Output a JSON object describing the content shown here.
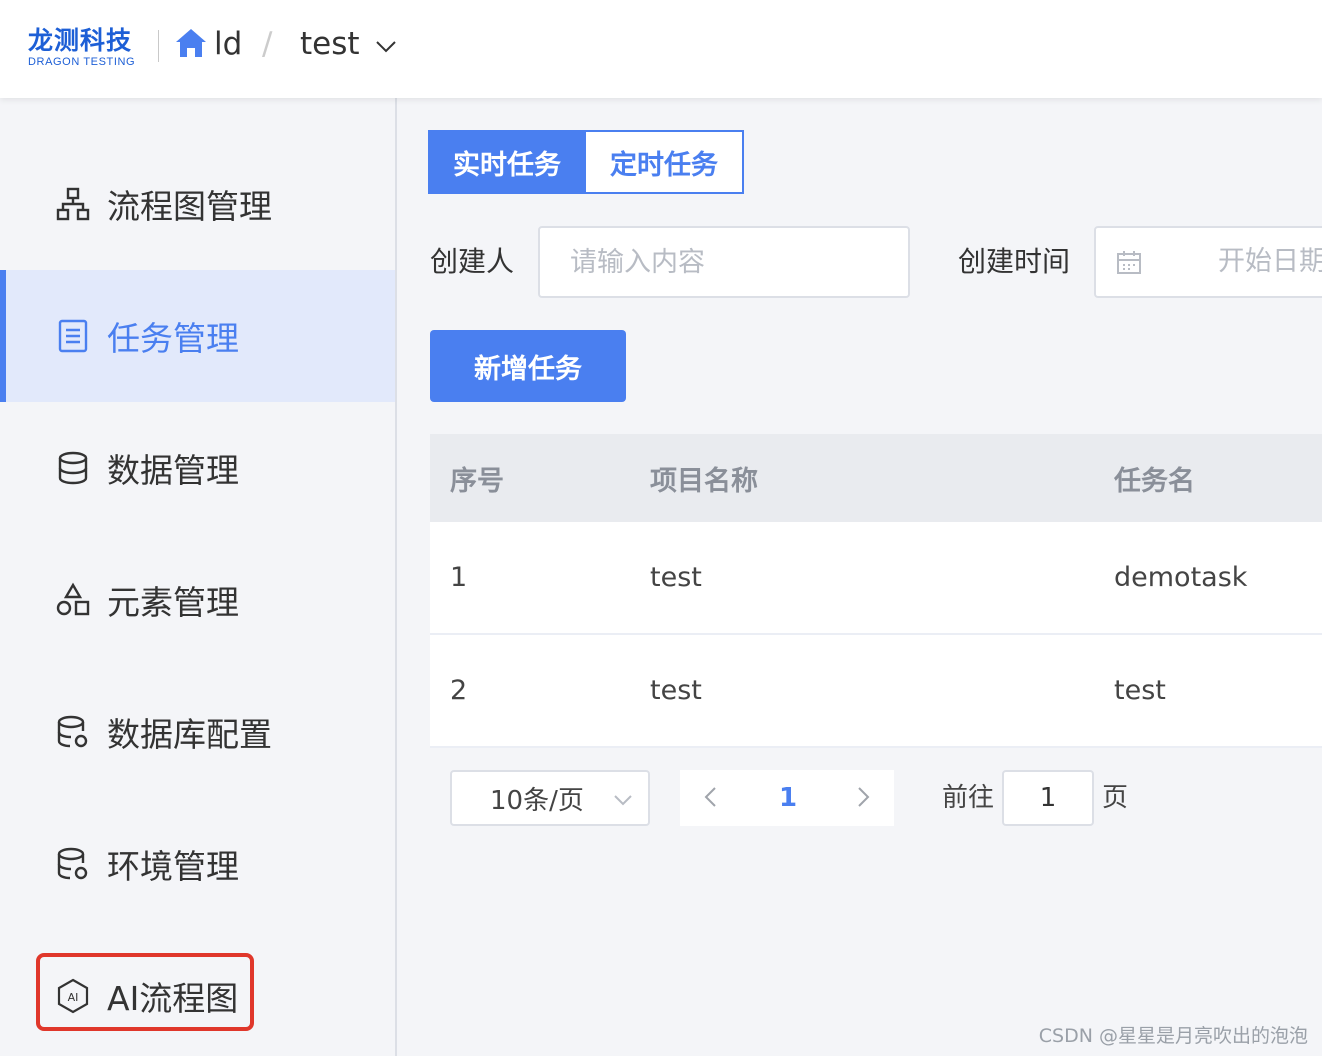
{
  "header": {
    "logo_cn": "龙测科技",
    "logo_en": "DRAGON TESTING",
    "project_name": "ld",
    "separator": "/",
    "current_project": "test"
  },
  "sidebar": {
    "items": [
      {
        "label": "流程图管理",
        "icon": "flowchart-icon",
        "active": false
      },
      {
        "label": "任务管理",
        "icon": "document-icon",
        "active": true
      },
      {
        "label": "数据管理",
        "icon": "database-icon",
        "active": false
      },
      {
        "label": "元素管理",
        "icon": "shapes-icon",
        "active": false
      },
      {
        "label": "数据库配置",
        "icon": "database-settings-icon",
        "active": false
      },
      {
        "label": "环境管理",
        "icon": "database-settings-icon",
        "active": false
      },
      {
        "label": "AI流程图",
        "icon": "ai-hexagon-icon",
        "active": false
      }
    ]
  },
  "tabs": [
    {
      "label": "实时任务",
      "active": true
    },
    {
      "label": "定时任务",
      "active": false
    }
  ],
  "filters": {
    "creator_label": "创建人",
    "creator_placeholder": "请输入内容",
    "created_time_label": "创建时间",
    "start_date_placeholder": "开始日期"
  },
  "actions": {
    "add_task_label": "新增任务"
  },
  "table": {
    "columns": [
      "序号",
      "项目名称",
      "任务名"
    ],
    "rows": [
      [
        "1",
        "test",
        "demotask"
      ],
      [
        "2",
        "test",
        "test"
      ]
    ]
  },
  "pagination": {
    "page_size": "10条/页",
    "current_page": "1",
    "goto_label": "前往",
    "goto_value": "1",
    "page_suffix": "页"
  },
  "watermark": "CSDN @星星是月亮吹出的泡泡",
  "colors": {
    "accent": "#4a7ff0",
    "logo": "#1d5fd6",
    "highlight": "#e0372b"
  }
}
